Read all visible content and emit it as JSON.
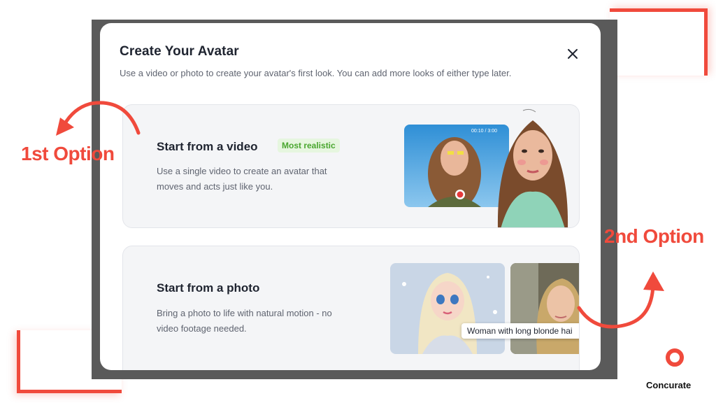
{
  "modal": {
    "title": "Create Your Avatar",
    "subtitle": "Use a video or photo to create your avatar's first look. You can add more looks of either type later.",
    "close_icon": "close-icon"
  },
  "video_option": {
    "title": "Start from a video",
    "badge": "Most realistic",
    "description_line1": "Use a single video to create an avatar that",
    "description_line2": "moves and acts just like you.",
    "timer": "00:10 / 3:00"
  },
  "photo_option": {
    "title": "Start from a photo",
    "description_line1": "Bring a photo to life with natural motion - no",
    "description_line2": "video footage needed.",
    "tooltip": "Woman with long blonde hai"
  },
  "annotations": {
    "first": "1st Option",
    "second": "2nd Option"
  },
  "brand": {
    "name": "Concurate"
  },
  "colors": {
    "accent": "#f04a3c",
    "badge_bg": "#e6f6df",
    "badge_text": "#49a62f",
    "card_bg": "#f4f5f7"
  }
}
